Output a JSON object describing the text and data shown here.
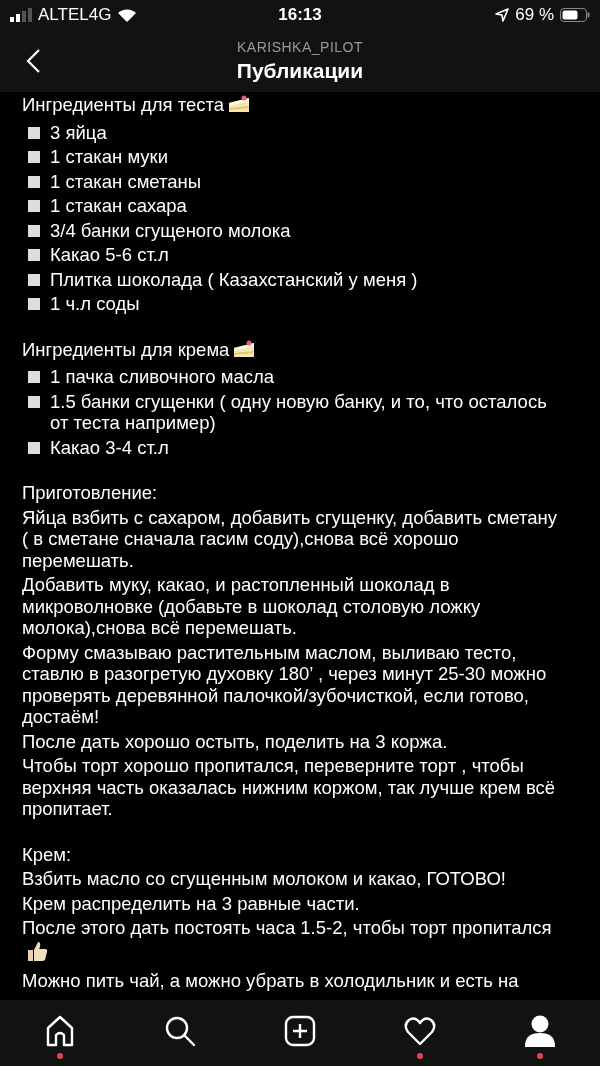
{
  "status_bar": {
    "carrier": "ALTEL4G",
    "time": "16:13",
    "battery": "69 %"
  },
  "header": {
    "username": "KARISHKA_PILOT",
    "title": "Публикации"
  },
  "sections": [
    {
      "heading": "Ингредиенты для теста",
      "kind": "ingredients",
      "items": [
        {
          "kind": "bullet",
          "text": "3 яйца"
        },
        {
          "kind": "bullet",
          "text": "1 стакан муки"
        },
        {
          "kind": "bullet",
          "text": "1 стакан сметаны"
        },
        {
          "kind": "bullet",
          "text": "1 стакан сахара"
        },
        {
          "kind": "bullet",
          "text": "3/4 банки сгущеного молока"
        },
        {
          "kind": "bullet",
          "text": "Какао 5-6 ст.л"
        },
        {
          "kind": "bullet",
          "text": "Плитка шоколада ( Казахстанский у меня )"
        },
        {
          "kind": "bullet",
          "text": "1 ч.л соды"
        }
      ]
    },
    {
      "heading": "Ингредиенты для крема",
      "kind": "ingredients",
      "items": [
        {
          "kind": "bullet",
          "text": "1 пачка сливочного масла"
        },
        {
          "kind": "bullet",
          "text": "1.5 банки сгущенки ( одну новую банку, и то, что осталось от теста например)"
        },
        {
          "kind": "bullet",
          "text": "Какао 3-4 ст.л"
        }
      ]
    },
    {
      "heading": "Приготовление:",
      "kind": "steps",
      "items": [
        {
          "kind": "text",
          "text": "Яйца взбить с сахаром, добавить сгущенку, добавить сметану ( в сметане сначала гасим соду),снова всё хорошо перемешать."
        },
        {
          "kind": "text",
          "text": "Добавить муку, какао, и растопленный шоколад в микроволновке (добавьте в шоколад столовую ложку молока),снова всё перемешать."
        },
        {
          "kind": "text",
          "text": "Форму смазываю растительным маслом, выливаю тесто, ставлю в разогретую духовку 180’ , через минут 25-30 можно проверять деревянной палочкой/зубочисткой, если готово, достаём!"
        },
        {
          "kind": "text",
          "text": "После дать хорошо остыть, поделить на 3 коржа."
        },
        {
          "kind": "text",
          "text": "Чтобы торт хорошо пропитался, переверните торт , чтобы верхняя часть  оказалась нижним коржом, так лучше крем всё пропитает."
        }
      ]
    },
    {
      "heading": "Крем:",
      "kind": "steps",
      "items": [
        {
          "kind": "text",
          "text": "Взбить масло со сгущенным молоком и какао, ГОТОВО!"
        },
        {
          "kind": "text",
          "text": "Крем распределить на 3 равные части."
        },
        {
          "kind": "thumbs",
          "text": "После этого дать постоять часа 1.5-2, чтобы торт пропитался"
        },
        {
          "kind": "text",
          "text": "Можно пить чай, а можно убрать в холодильник и есть на"
        }
      ]
    }
  ],
  "tab_bar": [
    {
      "kind": "home",
      "selected": false,
      "dot": true
    },
    {
      "kind": "search",
      "selected": false,
      "dot": false
    },
    {
      "kind": "new-post",
      "selected": false,
      "dot": false
    },
    {
      "kind": "activity",
      "selected": false,
      "dot": true
    },
    {
      "kind": "profile",
      "selected": true,
      "dot": true
    }
  ]
}
